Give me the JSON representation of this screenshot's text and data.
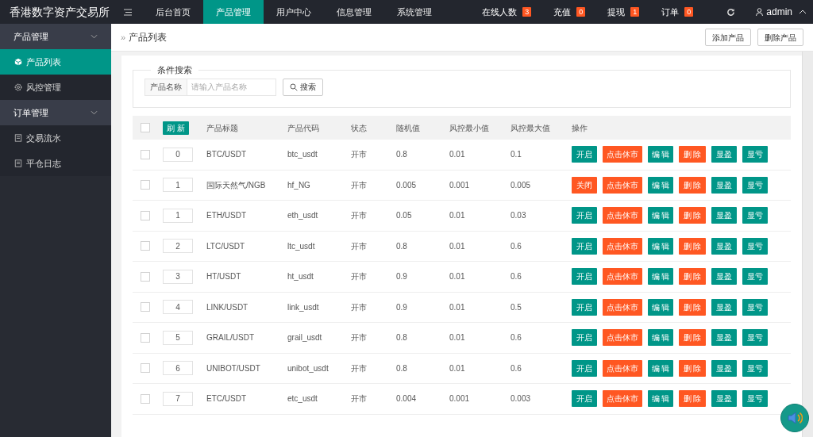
{
  "header": {
    "title": "香港数字资产交易所",
    "nav": [
      {
        "label": "后台首页",
        "selected": false
      },
      {
        "label": "产品管理",
        "selected": true
      },
      {
        "label": "用户中心",
        "selected": false
      },
      {
        "label": "信息管理",
        "selected": false
      },
      {
        "label": "系统管理",
        "selected": false
      }
    ],
    "stats": [
      {
        "label": "在线人数",
        "count": "3"
      },
      {
        "label": "充值",
        "count": "0"
      },
      {
        "label": "提现",
        "count": "1"
      },
      {
        "label": "订单",
        "count": "0"
      }
    ],
    "user": "admin"
  },
  "sidebar": {
    "groups": [
      {
        "label": "产品管理",
        "expanded": true,
        "items": [
          {
            "label": "产品列表",
            "selected": true
          },
          {
            "label": "风控管理",
            "selected": false
          }
        ]
      },
      {
        "label": "订单管理",
        "expanded": true,
        "items": [
          {
            "label": "交易流水",
            "selected": false
          },
          {
            "label": "平仓日志",
            "selected": false
          }
        ]
      }
    ]
  },
  "breadcrumb": {
    "separator": "»",
    "label": "产品列表"
  },
  "toolbar_buttons": [
    "添加产品",
    "删除产品"
  ],
  "search": {
    "legend": "条件搜索",
    "field_label": "产品名称",
    "placeholder": "请输入产品名称",
    "button": "搜索"
  },
  "table": {
    "select_all_checked": false,
    "refresh_button": "刷 新",
    "columns": [
      "产品标题",
      "产品代码",
      "状态",
      "随机值",
      "风控最小值",
      "风控最大值",
      "操作"
    ],
    "rows": [
      {
        "checked": false,
        "sort": "0",
        "title": "BTC/USDT",
        "code": "btc_usdt",
        "status": "开市",
        "random": "0.8",
        "min": "0.01",
        "max": "0.1",
        "toggle_label": "开启",
        "toggle_on": true,
        "actions": [
          "点击休市",
          "编 辑",
          "删 除",
          "显盈",
          "显亏"
        ]
      },
      {
        "checked": false,
        "sort": "1",
        "title": "国际天然气/NGB",
        "code": "hf_NG",
        "status": "开市",
        "random": "0.005",
        "min": "0.001",
        "max": "0.005",
        "toggle_label": "关闭",
        "toggle_on": false,
        "actions": [
          "点击休市",
          "编 辑",
          "删 除",
          "显盈",
          "显亏"
        ]
      },
      {
        "checked": false,
        "sort": "1",
        "title": "ETH/USDT",
        "code": "eth_usdt",
        "status": "开市",
        "random": "0.05",
        "min": "0.01",
        "max": "0.03",
        "toggle_label": "开启",
        "toggle_on": true,
        "actions": [
          "点击休市",
          "编 辑",
          "删 除",
          "显盈",
          "显亏"
        ]
      },
      {
        "checked": false,
        "sort": "2",
        "title": "LTC/USDT",
        "code": "ltc_usdt",
        "status": "开市",
        "random": "0.8",
        "min": "0.01",
        "max": "0.6",
        "toggle_label": "开启",
        "toggle_on": true,
        "actions": [
          "点击休市",
          "编 辑",
          "删 除",
          "显盈",
          "显亏"
        ]
      },
      {
        "checked": false,
        "sort": "3",
        "title": "HT/USDT",
        "code": "ht_usdt",
        "status": "开市",
        "random": "0.9",
        "min": "0.01",
        "max": "0.6",
        "toggle_label": "开启",
        "toggle_on": true,
        "actions": [
          "点击休市",
          "编 辑",
          "删 除",
          "显盈",
          "显亏"
        ]
      },
      {
        "checked": false,
        "sort": "4",
        "title": "LINK/USDT",
        "code": "link_usdt",
        "status": "开市",
        "random": "0.9",
        "min": "0.01",
        "max": "0.5",
        "toggle_label": "开启",
        "toggle_on": true,
        "actions": [
          "点击休市",
          "编 辑",
          "删 除",
          "显盈",
          "显亏"
        ]
      },
      {
        "checked": false,
        "sort": "5",
        "title": "GRAIL/USDT",
        "code": "grail_usdt",
        "status": "开市",
        "random": "0.8",
        "min": "0.01",
        "max": "0.6",
        "toggle_label": "开启",
        "toggle_on": true,
        "actions": [
          "点击休市",
          "编 辑",
          "删 除",
          "显盈",
          "显亏"
        ]
      },
      {
        "checked": false,
        "sort": "6",
        "title": "UNIBOT/USDT",
        "code": "unibot_usdt",
        "status": "开市",
        "random": "0.8",
        "min": "0.01",
        "max": "0.6",
        "toggle_label": "开启",
        "toggle_on": true,
        "actions": [
          "点击休市",
          "编 辑",
          "删 除",
          "显盈",
          "显亏"
        ]
      },
      {
        "checked": false,
        "sort": "7",
        "title": "ETC/USDT",
        "code": "etc_usdt",
        "status": "开市",
        "random": "0.004",
        "min": "0.001",
        "max": "0.003",
        "toggle_label": "开启",
        "toggle_on": true,
        "actions": [
          "点击休市",
          "编 辑",
          "删 除",
          "显盈",
          "显亏"
        ]
      }
    ]
  }
}
